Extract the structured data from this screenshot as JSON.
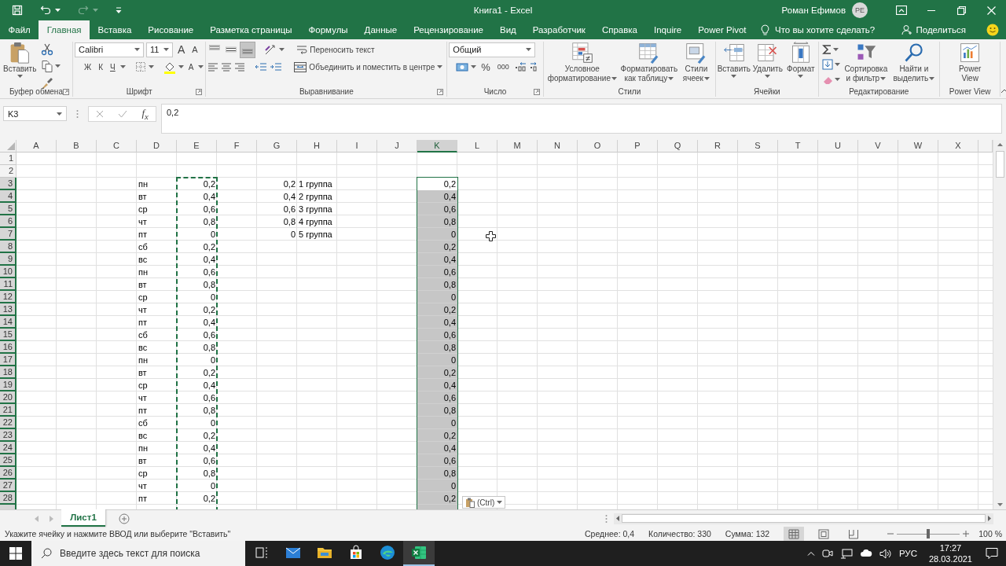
{
  "window": {
    "title": "Книга1 - Excel",
    "user": "Роман Ефимов",
    "user_initials": "PE"
  },
  "quick_access": {
    "redo": {
      "disabled": true
    }
  },
  "tabs": [
    {
      "label": "Файл",
      "selected": false
    },
    {
      "label": "Главная",
      "selected": true
    },
    {
      "label": "Вставка",
      "selected": false
    },
    {
      "label": "Рисование",
      "selected": false
    },
    {
      "label": "Разметка страницы",
      "selected": false
    },
    {
      "label": "Формулы",
      "selected": false
    },
    {
      "label": "Данные",
      "selected": false
    },
    {
      "label": "Рецензирование",
      "selected": false
    },
    {
      "label": "Вид",
      "selected": false
    },
    {
      "label": "Разработчик",
      "selected": false
    },
    {
      "label": "Справка",
      "selected": false
    },
    {
      "label": "Inquire",
      "selected": false
    },
    {
      "label": "Power Pivot",
      "selected": false
    }
  ],
  "tell_me": {
    "placeholder": "Что вы хотите сделать?"
  },
  "share": {
    "label": "Поделиться"
  },
  "ribbon": {
    "clipboard": {
      "label": "Буфер обмена",
      "paste": "Вставить"
    },
    "font": {
      "label": "Шрифт",
      "name": "Calibri",
      "size": "11",
      "grow": "A",
      "shrink": "A",
      "bold": "Ж",
      "italic": "К",
      "underline": "Ч",
      "color_button": "A"
    },
    "alignment": {
      "label": "Выравнивание",
      "vertical": [
        {
          "kind": "top",
          "selected": false
        },
        {
          "kind": "middle",
          "selected": false
        },
        {
          "kind": "bottom",
          "selected": true
        }
      ],
      "wrap": "Переносить текст",
      "merge": "Объединить и поместить в центре"
    },
    "number": {
      "label": "Число",
      "format": "Общий",
      "percent": "%",
      "thousands": "000"
    },
    "styles": {
      "label": "Стили",
      "buttons": [
        {
          "kind": "conditional",
          "label": "Условное форматирование"
        },
        {
          "kind": "table",
          "label": "Форматировать как таблицу"
        },
        {
          "kind": "cell-styles",
          "label": "Стили ячеек"
        }
      ]
    },
    "cells": {
      "label": "Ячейки",
      "buttons": [
        {
          "kind": "insert",
          "label": "Вставить"
        },
        {
          "kind": "delete",
          "label": "Удалить"
        },
        {
          "kind": "format",
          "label": "Формат"
        }
      ]
    },
    "editing": {
      "label": "Редактирование",
      "buttons": [
        {
          "kind": "sort",
          "label": "Сортировка и фильтр"
        },
        {
          "kind": "find",
          "label": "Найти и выделить"
        }
      ]
    },
    "power_view": {
      "label": "Power View",
      "button": "Power View"
    }
  },
  "formula_bar": {
    "name_box": "K3",
    "fx": "f$_{x}$",
    "formula": "0,2"
  },
  "sheet": {
    "columns": [
      {
        "label": "A",
        "kind": "text",
        "selected": false,
        "copied": false
      },
      {
        "label": "B",
        "kind": "text",
        "selected": false,
        "copied": false
      },
      {
        "label": "C",
        "kind": "text",
        "selected": false,
        "copied": false
      },
      {
        "label": "D",
        "kind": "text",
        "selected": false,
        "copied": false
      },
      {
        "label": "E",
        "kind": "number",
        "selected": false,
        "copied": true
      },
      {
        "label": "F",
        "kind": "text",
        "selected": false,
        "copied": false
      },
      {
        "label": "G",
        "kind": "number",
        "selected": false,
        "copied": false
      },
      {
        "label": "H",
        "kind": "text",
        "selected": false,
        "copied": false
      },
      {
        "label": "I",
        "kind": "text",
        "selected": false,
        "copied": false
      },
      {
        "label": "J",
        "kind": "text",
        "selected": false,
        "copied": false
      },
      {
        "label": "K",
        "kind": "number",
        "selected": true,
        "copied": false
      },
      {
        "label": "L",
        "kind": "text",
        "selected": false,
        "copied": false
      },
      {
        "label": "M",
        "kind": "text",
        "selected": false,
        "copied": false
      },
      {
        "label": "N",
        "kind": "text",
        "selected": false,
        "copied": false
      },
      {
        "label": "O",
        "kind": "text",
        "selected": false,
        "copied": false
      },
      {
        "label": "P",
        "kind": "text",
        "selected": false,
        "copied": false
      },
      {
        "label": "Q",
        "kind": "text",
        "selected": false,
        "copied": false
      },
      {
        "label": "R",
        "kind": "text",
        "selected": false,
        "copied": false
      },
      {
        "label": "S",
        "kind": "text",
        "selected": false,
        "copied": false
      },
      {
        "label": "T",
        "kind": "text",
        "selected": false,
        "copied": false
      },
      {
        "label": "U",
        "kind": "text",
        "selected": false,
        "copied": false
      },
      {
        "label": "V",
        "kind": "text",
        "selected": false,
        "copied": false
      },
      {
        "label": "W",
        "kind": "text",
        "selected": false,
        "copied": false
      },
      {
        "label": "X",
        "kind": "text",
        "selected": false,
        "copied": false
      }
    ],
    "rows": [
      {
        "number": "1",
        "selected": false
      },
      {
        "number": "2",
        "selected": false
      },
      {
        "number": "3",
        "selected": true,
        "cells": {
          "D": "пн",
          "E": "0,2",
          "G": "0,2",
          "H": "1 группа",
          "K": "0,2"
        }
      },
      {
        "number": "4",
        "selected": true,
        "cells": {
          "D": "вт",
          "E": "0,4",
          "G": "0,4",
          "H": "2 группа",
          "K": "0,4"
        }
      },
      {
        "number": "5",
        "selected": true,
        "cells": {
          "D": "ср",
          "E": "0,6",
          "G": "0,6",
          "H": "3 группа",
          "K": "0,6"
        }
      },
      {
        "number": "6",
        "selected": true,
        "cells": {
          "D": "чт",
          "E": "0,8",
          "G": "0,8",
          "H": "4 группа",
          "K": "0,8"
        }
      },
      {
        "number": "7",
        "selected": true,
        "cells": {
          "D": "пт",
          "E": "0",
          "G": "0",
          "H": "5 группа",
          "K": "0"
        }
      },
      {
        "number": "8",
        "selected": true,
        "cells": {
          "D": "сб",
          "E": "0,2",
          "K": "0,2"
        }
      },
      {
        "number": "9",
        "selected": true,
        "cells": {
          "D": "вс",
          "E": "0,4",
          "K": "0,4"
        }
      },
      {
        "number": "10",
        "selected": true,
        "cells": {
          "D": "пн",
          "E": "0,6",
          "K": "0,6"
        }
      },
      {
        "number": "11",
        "selected": true,
        "cells": {
          "D": "вт",
          "E": "0,8",
          "K": "0,8"
        }
      },
      {
        "number": "12",
        "selected": true,
        "cells": {
          "D": "ср",
          "E": "0",
          "K": "0"
        }
      },
      {
        "number": "13",
        "selected": true,
        "cells": {
          "D": "чт",
          "E": "0,2",
          "K": "0,2"
        }
      },
      {
        "number": "14",
        "selected": true,
        "cells": {
          "D": "пт",
          "E": "0,4",
          "K": "0,4"
        }
      },
      {
        "number": "15",
        "selected": true,
        "cells": {
          "D": "сб",
          "E": "0,6",
          "K": "0,6"
        }
      },
      {
        "number": "16",
        "selected": true,
        "cells": {
          "D": "вс",
          "E": "0,8",
          "K": "0,8"
        }
      },
      {
        "number": "17",
        "selected": true,
        "cells": {
          "D": "пн",
          "E": "0",
          "K": "0"
        }
      },
      {
        "number": "18",
        "selected": true,
        "cells": {
          "D": "вт",
          "E": "0,2",
          "K": "0,2"
        }
      },
      {
        "number": "19",
        "selected": true,
        "cells": {
          "D": "ср",
          "E": "0,4",
          "K": "0,4"
        }
      },
      {
        "number": "20",
        "selected": true,
        "cells": {
          "D": "чт",
          "E": "0,6",
          "K": "0,6"
        }
      },
      {
        "number": "21",
        "selected": true,
        "cells": {
          "D": "пт",
          "E": "0,8",
          "K": "0,8"
        }
      },
      {
        "number": "22",
        "selected": true,
        "cells": {
          "D": "сб",
          "E": "0",
          "K": "0"
        }
      },
      {
        "number": "23",
        "selected": true,
        "cells": {
          "D": "вс",
          "E": "0,2",
          "K": "0,2"
        }
      },
      {
        "number": "24",
        "selected": true,
        "cells": {
          "D": "пн",
          "E": "0,4",
          "K": "0,4"
        }
      },
      {
        "number": "25",
        "selected": true,
        "cells": {
          "D": "вт",
          "E": "0,6",
          "K": "0,6"
        }
      },
      {
        "number": "26",
        "selected": true,
        "cells": {
          "D": "ср",
          "E": "0,8",
          "K": "0,8"
        }
      },
      {
        "number": "27",
        "selected": true,
        "cells": {
          "D": "чт",
          "E": "0",
          "K": "0"
        }
      },
      {
        "number": "28",
        "selected": true,
        "cells": {
          "D": "пт",
          "E": "0,2",
          "K": "0,2"
        }
      }
    ],
    "paste_options": "(Ctrl)"
  },
  "sheet_tabs": [
    {
      "label": "Лист1",
      "selected": true
    }
  ],
  "status_bar": {
    "message": "Укажите ячейку и нажмите ВВОД или выберите \"Вставить\"",
    "average": "Среднее: 0,4",
    "count": "Количество: 330",
    "sum": "Сумма: 132",
    "views": [
      {
        "kind": "normal",
        "selected": true
      },
      {
        "kind": "page-layout",
        "selected": false
      },
      {
        "kind": "page-break",
        "selected": false
      }
    ],
    "zoom_slider": {
      "level": 0.5
    },
    "zoom": "100 %"
  },
  "taskbar": {
    "search": {
      "placeholder": "Введите здесь текст для поиска"
    },
    "apps": [
      {
        "kind": "task-view",
        "active": false
      },
      {
        "kind": "mail",
        "active": false
      },
      {
        "kind": "explorer",
        "active": false
      },
      {
        "kind": "store",
        "active": false
      },
      {
        "kind": "edge",
        "active": false
      },
      {
        "kind": "excel",
        "active": true
      }
    ],
    "language": "РУС",
    "time": "17:27",
    "date": "28.03.2021"
  }
}
